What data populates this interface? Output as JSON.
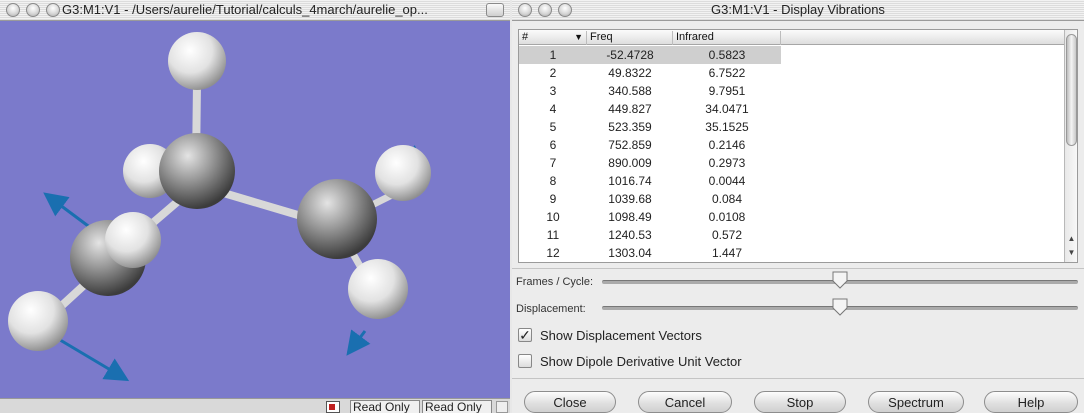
{
  "left_window": {
    "title": "G3:M1:V1 - /Users/aurelie/Tutorial/calculs_4march/aurelie_op...",
    "status": {
      "read_only_1": "Read Only",
      "read_only_2": "Read Only"
    }
  },
  "right_window": {
    "title": "G3:M1:V1 - Display Vibrations",
    "table": {
      "headers": {
        "num": "#",
        "freq": "Freq",
        "infrared": "Infrared"
      },
      "rows": [
        {
          "num": "1",
          "freq": "-52.4728",
          "ir": "0.5823",
          "selected": true
        },
        {
          "num": "2",
          "freq": "49.8322",
          "ir": "6.7522"
        },
        {
          "num": "3",
          "freq": "340.588",
          "ir": "9.7951"
        },
        {
          "num": "4",
          "freq": "449.827",
          "ir": "34.0471"
        },
        {
          "num": "5",
          "freq": "523.359",
          "ir": "35.1525"
        },
        {
          "num": "6",
          "freq": "752.859",
          "ir": "0.2146"
        },
        {
          "num": "7",
          "freq": "890.009",
          "ir": "0.2973"
        },
        {
          "num": "8",
          "freq": "1016.74",
          "ir": "0.0044"
        },
        {
          "num": "9",
          "freq": "1039.68",
          "ir": "0.084"
        },
        {
          "num": "10",
          "freq": "1098.49",
          "ir": "0.0108"
        },
        {
          "num": "11",
          "freq": "1240.53",
          "ir": "0.572"
        },
        {
          "num": "12",
          "freq": "1303.04",
          "ir": "1.447"
        }
      ]
    },
    "frames_label": "Frames / Cycle:",
    "frames_value": 0.5,
    "displacement_label": "Displacement:",
    "displacement_value": 0.5,
    "show_displacement_vectors": {
      "label": "Show Displacement Vectors",
      "checked": true
    },
    "show_dipole": {
      "label": "Show Dipole Derivative Unit Vector",
      "checked": false
    },
    "buttons": {
      "close": "Close",
      "cancel": "Cancel",
      "stop": "Stop",
      "spectrum": "Spectrum",
      "help": "Help"
    }
  },
  "colors": {
    "viewer_bg": "#7b7acb",
    "vector": "#1a6fb0",
    "selected_row": "#cfcfcf"
  }
}
